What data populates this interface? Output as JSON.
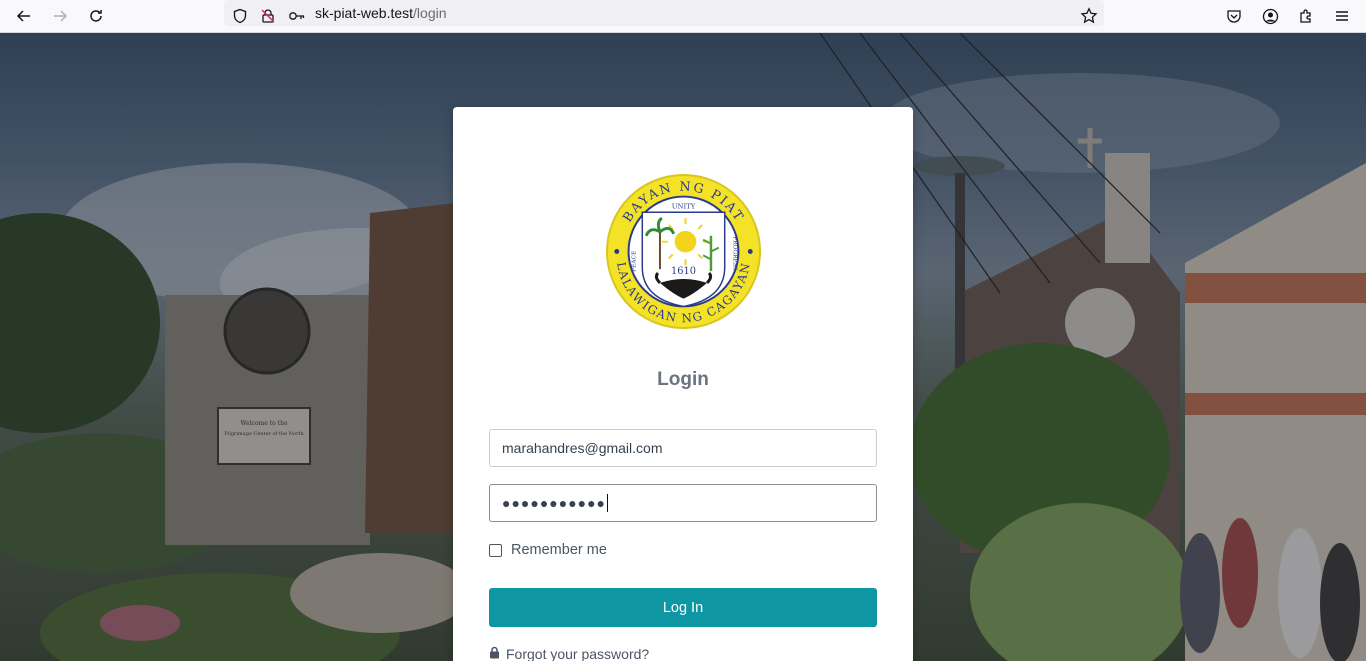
{
  "browser": {
    "url_host": "sk-piat-web.test",
    "url_path": "/login",
    "icons": [
      "back-icon",
      "forward-icon",
      "reload-icon",
      "shield-icon",
      "blocked-permission-icon",
      "key-icon",
      "bookmark-star-icon",
      "pocket-icon",
      "account-icon",
      "extensions-icon",
      "menu-icon"
    ]
  },
  "background": {
    "plaque_title": "Welcome to the",
    "plaque_subtitle": "Pilgrimage Center of the North"
  },
  "seal": {
    "top_text": "BAYAN NG PIAT",
    "bottom_text": "LALAWIGAN NG CAGAYAN",
    "unity": "UNITY",
    "peace": "PEACE",
    "progress": "PROGRESS",
    "year": "1610",
    "colors": {
      "ring": "#f4e227",
      "border": "#2a3a8c"
    }
  },
  "login": {
    "title": "Login",
    "email_value": "marahandres@gmail.com",
    "password_mask": "●●●●●●●●●●●",
    "remember_label": "Remember me",
    "submit_label": "Log In",
    "forgot_label": "Forgot your password?",
    "colors": {
      "button": "#0e97a3"
    }
  }
}
